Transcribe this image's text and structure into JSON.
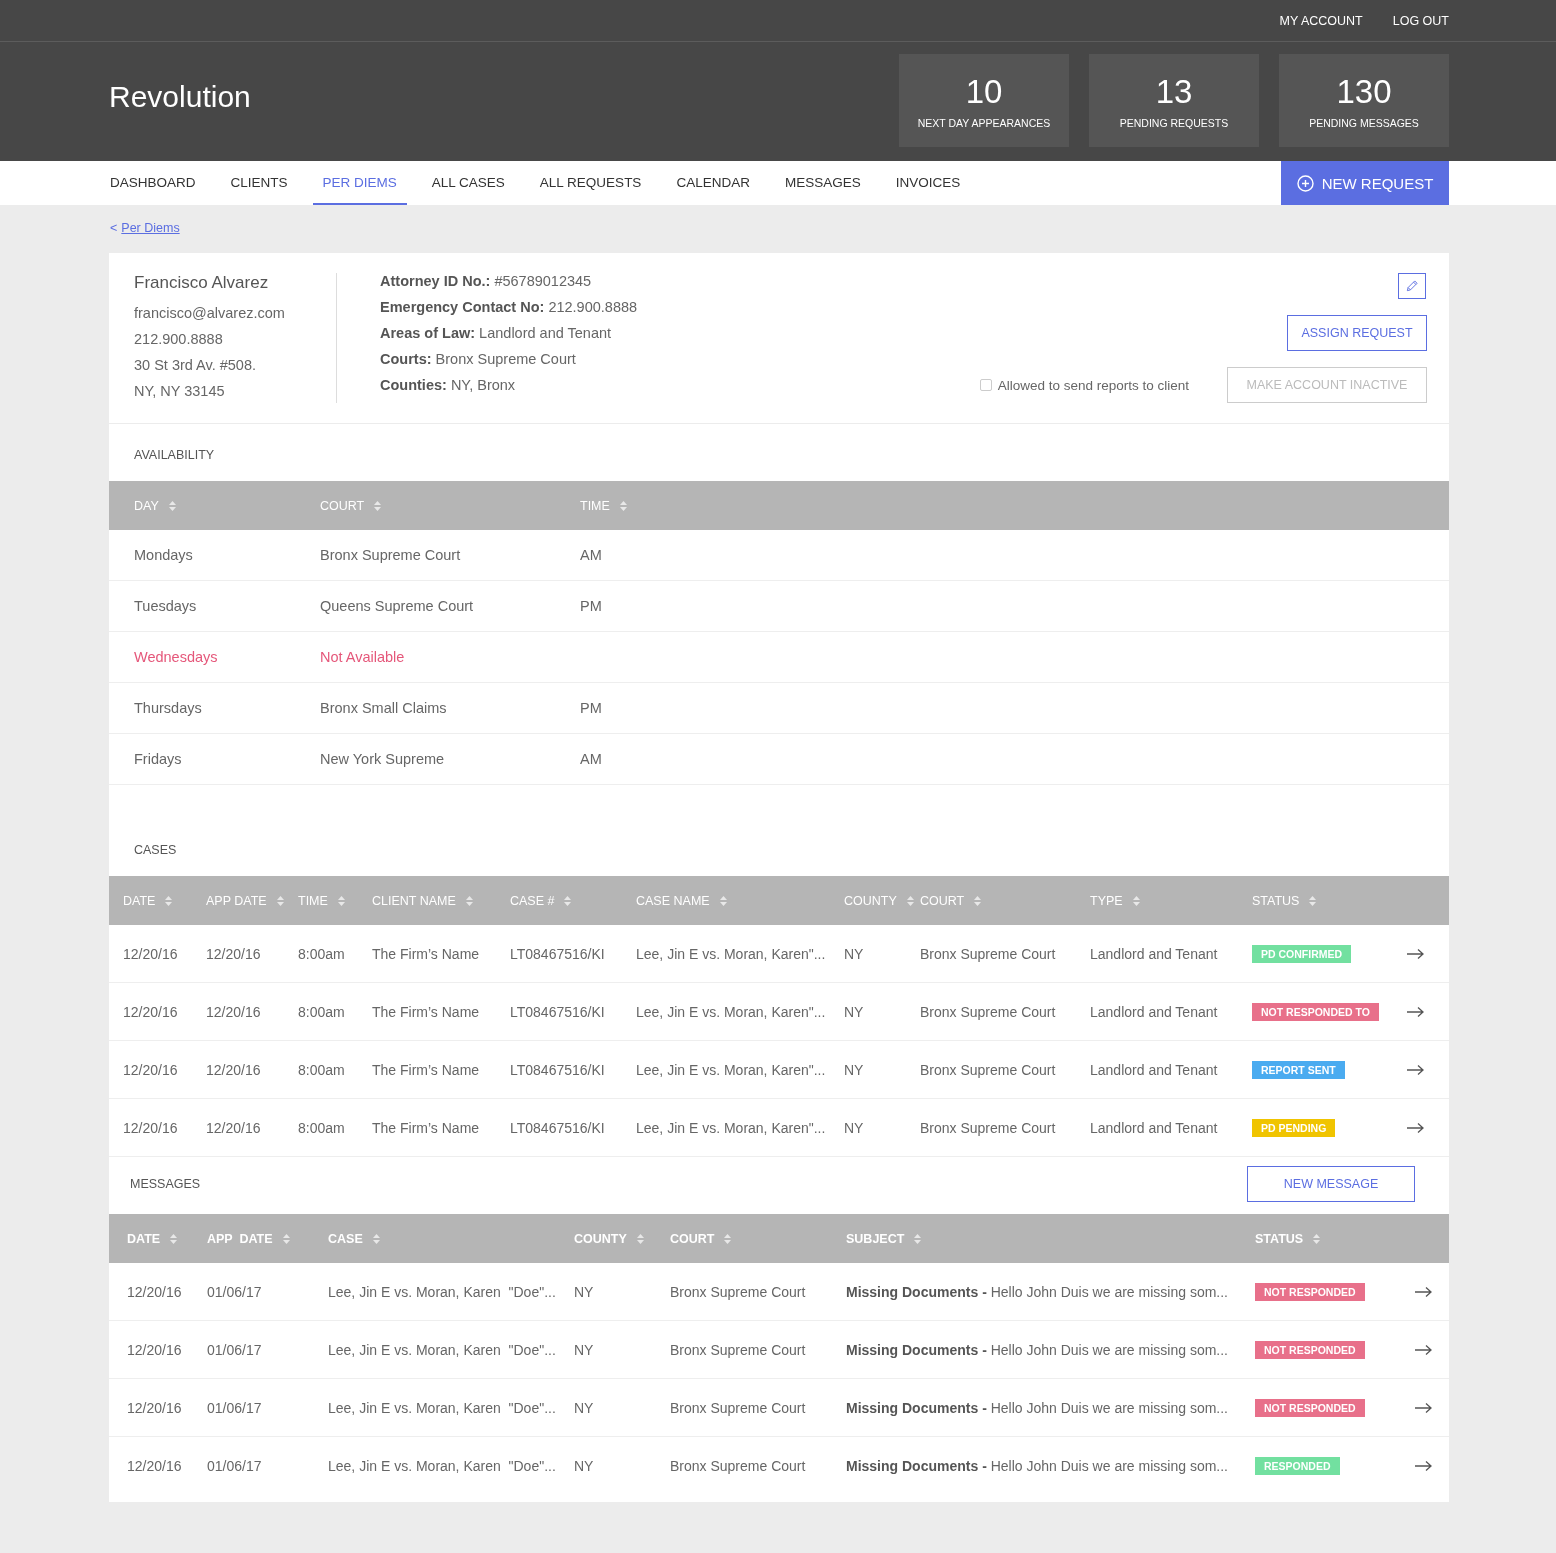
{
  "top_bar": {
    "links": [
      "MY ACCOUNT",
      "LOG OUT"
    ]
  },
  "header": {
    "title": "Revolution",
    "stats": [
      {
        "value": "10",
        "label": "NEXT DAY APPEARANCES"
      },
      {
        "value": "13",
        "label": "PENDING REQUESTS"
      },
      {
        "value": "130",
        "label": "PENDING MESSAGES"
      }
    ]
  },
  "nav": {
    "items": [
      {
        "label": "DASHBOARD",
        "selected": false
      },
      {
        "label": "CLIENTS",
        "selected": false
      },
      {
        "label": "PER DIEMS",
        "selected": true
      },
      {
        "label": "ALL CASES",
        "selected": false
      },
      {
        "label": "ALL REQUESTS",
        "selected": false
      },
      {
        "label": "CALENDAR",
        "selected": false
      },
      {
        "label": "MESSAGES",
        "selected": false
      },
      {
        "label": "INVOICES",
        "selected": false
      }
    ],
    "new_request_button": "NEW REQUEST"
  },
  "breadcrumb": {
    "arrow": "<",
    "link": "Per Diems"
  },
  "profile": {
    "name": "Francisco Alvarez",
    "contact": [
      "francisco@alvarez.com",
      "212.900.8888",
      "30 St 3rd Av. #508.",
      "NY, NY 33145"
    ],
    "details": [
      "**Attorney ID No.:** #56789012345",
      "**Emergency Contact No:** 212.900.8888",
      "**Areas of Law:** Landlord and Tenant",
      "**Courts:** Bronx Supreme Court",
      "**Counties:** NY, Bronx"
    ],
    "assign_button": "ASSIGN REQUEST",
    "reports_checkbox": {
      "label": "Allowed to send reports to client",
      "checked": false
    },
    "inactive_button": {
      "label": "MAKE ACCOUNT INACTIVE",
      "disabled": true
    }
  },
  "availability": {
    "title": "AVAILABILITY",
    "columns": [
      "DAY",
      "COURT",
      "TIME"
    ],
    "rows": [
      {
        "day": "Mondays",
        "court": "Bronx Supreme Court",
        "time": "AM",
        "available": true
      },
      {
        "day": "Tuesdays",
        "court": "Queens Supreme Court",
        "time": "PM",
        "available": true
      },
      {
        "day": "Wednesdays",
        "court": "Not Available",
        "available": false
      },
      {
        "day": "Thursdays",
        "court": "Bronx Small Claims",
        "time": "PM",
        "available": true
      },
      {
        "day": "Fridays",
        "court": "New York Supreme",
        "time": "AM",
        "available": true
      }
    ]
  },
  "cases": {
    "title": "CASES",
    "columns": [
      "DATE",
      "APP DATE",
      "TIME",
      "CLIENT NAME",
      "CASE #",
      "CASE NAME",
      "COUNTY",
      "COURT",
      "TYPE",
      "STATUS"
    ],
    "rows": [
      {
        "cells": [
          "12/20/16",
          "12/20/16",
          "8:00am",
          "The Firm’s Name",
          "LT08467516/KI",
          "Lee, Jin E vs. Moran, Karen\"...",
          "NY",
          "Bronx Supreme Court",
          "Landlord and Tenant"
        ],
        "status": {
          "label": "PD CONFIRMED",
          "color": "#72e0a0"
        }
      },
      {
        "cells": [
          "12/20/16",
          "12/20/16",
          "8:00am",
          "The Firm’s Name",
          "LT08467516/KI",
          "Lee, Jin E vs. Moran, Karen\"...",
          "NY",
          "Bronx Supreme Court",
          "Landlord and Tenant"
        ],
        "status": {
          "label": "NOT RESPONDED TO",
          "color": "#e8708a"
        }
      },
      {
        "cells": [
          "12/20/16",
          "12/20/16",
          "8:00am",
          "The Firm’s Name",
          "LT08467516/KI",
          "Lee, Jin E vs. Moran, Karen\"...",
          "NY",
          "Bronx Supreme Court",
          "Landlord and Tenant"
        ],
        "status": {
          "label": "REPORT SENT",
          "color": "#4aabf0"
        }
      },
      {
        "cells": [
          "12/20/16",
          "12/20/16",
          "8:00am",
          "The Firm’s Name",
          "LT08467516/KI",
          "Lee, Jin E vs. Moran, Karen\"...",
          "NY",
          "Bronx Supreme Court",
          "Landlord and Tenant"
        ],
        "status": {
          "label": "PD PENDING",
          "color": "#f0c400"
        }
      }
    ]
  },
  "messages": {
    "title": "MESSAGES",
    "new_message_button": "NEW MESSAGE",
    "columns": [
      "DATE",
      "APP  DATE",
      "CASE",
      "COUNTY",
      "COURT",
      "SUBJECT",
      "STATUS"
    ],
    "rows": [
      {
        "cells": [
          "12/20/16",
          "01/06/17",
          "Lee, Jin E vs. Moran, Karen  \"Doe\"...",
          "NY",
          "Bronx Supreme Court"
        ],
        "subject": "**Missing Documents -** Hello John Duis we are missing som...",
        "status": {
          "label": "NOT RESPONDED",
          "color": "#e8708a"
        }
      },
      {
        "cells": [
          "12/20/16",
          "01/06/17",
          "Lee, Jin E vs. Moran, Karen  \"Doe\"...",
          "NY",
          "Bronx Supreme Court"
        ],
        "subject": "**Missing Documents -** Hello John Duis we are missing som...",
        "status": {
          "label": "NOT RESPONDED",
          "color": "#e8708a"
        }
      },
      {
        "cells": [
          "12/20/16",
          "01/06/17",
          "Lee, Jin E vs. Moran, Karen  \"Doe\"...",
          "NY",
          "Bronx Supreme Court"
        ],
        "subject": "**Missing Documents -** Hello John Duis we are missing som...",
        "status": {
          "label": "NOT RESPONDED",
          "color": "#e8708a"
        }
      },
      {
        "cells": [
          "12/20/16",
          "01/06/17",
          "Lee, Jin E vs. Moran, Karen  \"Doe\"...",
          "NY",
          "Bronx Supreme Court"
        ],
        "subject": "**Missing Documents -** Hello John Duis we are missing som...",
        "status": {
          "label": "RESPONDED",
          "color": "#72e0a0"
        }
      }
    ]
  }
}
